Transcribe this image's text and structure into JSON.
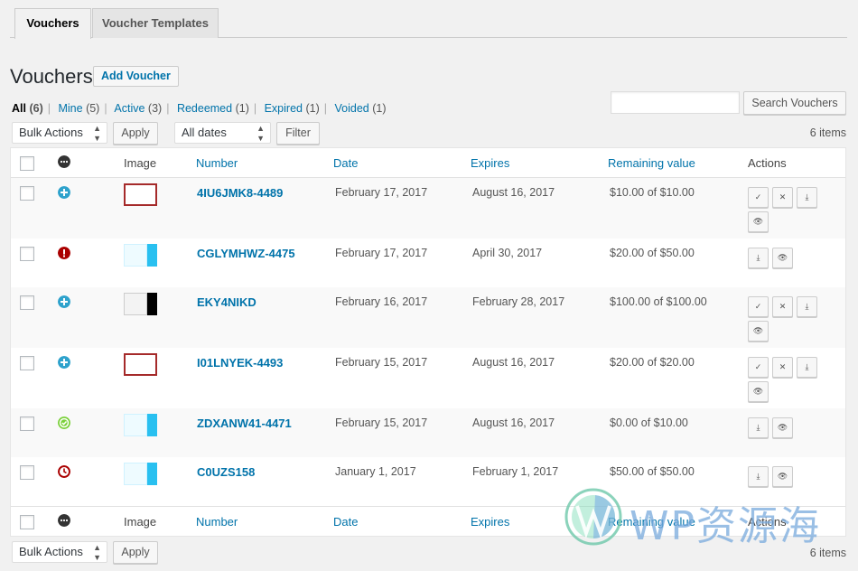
{
  "tabs": [
    {
      "label": "Vouchers",
      "active": true
    },
    {
      "label": "Voucher Templates",
      "active": false
    }
  ],
  "header": {
    "title": "Vouchers",
    "add_button": "Add Voucher"
  },
  "filters": [
    {
      "label": "All",
      "count": "(6)",
      "current": true
    },
    {
      "label": "Mine",
      "count": "(5)",
      "current": false
    },
    {
      "label": "Active",
      "count": "(3)",
      "current": false
    },
    {
      "label": "Redeemed",
      "count": "(1)",
      "current": false
    },
    {
      "label": "Expired",
      "count": "(1)",
      "current": false
    },
    {
      "label": "Voided",
      "count": "(1)",
      "current": false
    }
  ],
  "search": {
    "value": "",
    "placeholder": "",
    "button": "Search Vouchers"
  },
  "tablenav_top": {
    "bulk_actions": "Bulk Actions",
    "apply": "Apply",
    "dates": "All dates",
    "filter": "Filter",
    "items": "6 items"
  },
  "tablenav_bottom": {
    "bulk_actions": "Bulk Actions",
    "apply": "Apply",
    "items": "6 items"
  },
  "columns": {
    "image": "Image",
    "number": "Number",
    "date": "Date",
    "expires": "Expires",
    "remaining": "Remaining value",
    "actions": "Actions"
  },
  "colors": {
    "link": "#0073aa",
    "active": "#2ea2cc",
    "redeemed": "#7ad03a",
    "error": "#a00",
    "expired": "#a00"
  },
  "rows": [
    {
      "status": "active",
      "thumb": "red-frame",
      "number": "4IU6JMK8-4489",
      "date": "February 17, 2017",
      "expires": "August 16, 2017",
      "remaining": "$10.00 of $10.00",
      "actions": [
        "redeem",
        "void",
        "download",
        "view"
      ]
    },
    {
      "status": "error",
      "thumb": "cyan",
      "number": "CGLYMHWZ-4475",
      "date": "February 17, 2017",
      "expires": "April 30, 2017",
      "remaining": "$20.00 of $50.00",
      "actions": [
        "download",
        "view"
      ]
    },
    {
      "status": "active",
      "thumb": "black",
      "number": "EKY4NIKD",
      "date": "February 16, 2017",
      "expires": "February 28, 2017",
      "remaining": "$100.00 of $100.00",
      "actions": [
        "redeem",
        "void",
        "download",
        "view"
      ]
    },
    {
      "status": "active",
      "thumb": "red-frame",
      "number": "I01LNYEK-4493",
      "date": "February 15, 2017",
      "expires": "August 16, 2017",
      "remaining": "$20.00 of $20.00",
      "actions": [
        "redeem",
        "void",
        "download",
        "view"
      ]
    },
    {
      "status": "redeemed",
      "thumb": "cyan",
      "number": "ZDXANW41-4471",
      "date": "February 15, 2017",
      "expires": "August 16, 2017",
      "remaining": "$0.00 of $10.00",
      "actions": [
        "download",
        "view"
      ]
    },
    {
      "status": "expired",
      "thumb": "cyan",
      "number": "C0UZS158",
      "date": "January 1, 2017",
      "expires": "February 1, 2017",
      "remaining": "$50.00 of $50.00",
      "actions": [
        "download",
        "view"
      ]
    }
  ],
  "watermark": {
    "text": "WP资源海"
  }
}
